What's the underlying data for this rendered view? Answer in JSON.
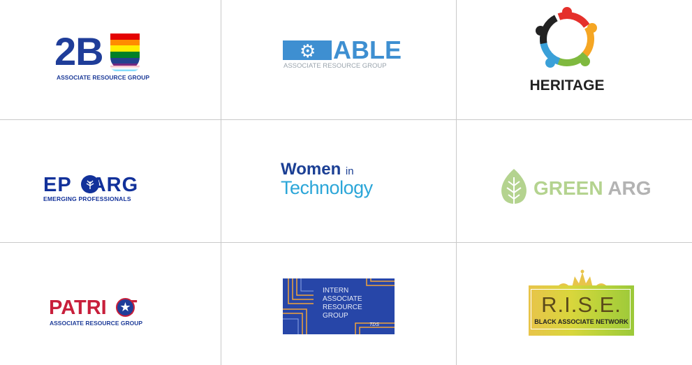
{
  "logos": {
    "tobu": {
      "main": "2B",
      "sub": "ASSOCIATE RESOURCE GROUP",
      "rainbow": [
        "#e40303",
        "#ff8c00",
        "#ffed00",
        "#008026",
        "#24408e",
        "#732982"
      ]
    },
    "able": {
      "main": "ABLE",
      "sub": "ASSOCIATE RESOURCE GROUP",
      "color": "#3e8fd1"
    },
    "heritage": {
      "main": "HERITAGE",
      "colors": [
        "#e5302b",
        "#f5a623",
        "#7fb93f",
        "#3aa0d8",
        "#222222"
      ]
    },
    "eparg": {
      "main_left": "EP",
      "main_right": "ARG",
      "sub": "EMERGING PROFESSIONALS",
      "color": "#12319a"
    },
    "women_in_tech": {
      "line1": "Women",
      "line1_small": "in",
      "line2": "Technology"
    },
    "green_arg": {
      "green": "GREEN",
      "arg": "ARG"
    },
    "patriot": {
      "main_left": "PATRI",
      "main_right": "T",
      "sub": "ASSOCIATE RESOURCE GROUP"
    },
    "intern": {
      "text": "INTERN\nASSOCIATE\nRESOURCE\nGROUP",
      "badge": "TDS"
    },
    "rise": {
      "main": "R.I.S.E.",
      "sub": "BLACK ASSOCIATE NETWORK"
    }
  }
}
